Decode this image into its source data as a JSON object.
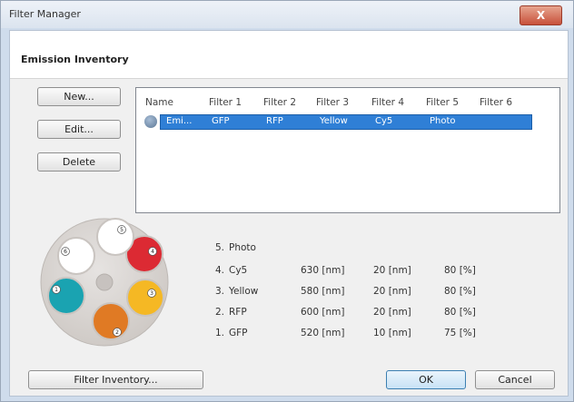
{
  "window": {
    "title": "Filter Manager",
    "close_glyph": "X"
  },
  "section": {
    "title": "Emission Inventory"
  },
  "buttons": {
    "new": "New...",
    "edit": "Edit...",
    "delete": "Delete",
    "filter_inventory": "Filter Inventory...",
    "ok": "OK",
    "cancel": "Cancel"
  },
  "table": {
    "columns": [
      "Name",
      "Filter 1",
      "Filter 2",
      "Filter 3",
      "Filter 4",
      "Filter 5",
      "Filter 6"
    ],
    "rows": [
      {
        "name": "Emi...",
        "filter1": "GFP",
        "filter2": "RFP",
        "filter3": "Yellow",
        "filter4": "Cy5",
        "filter5": "Photo",
        "filter6": "",
        "selected": true
      }
    ]
  },
  "wheel": {
    "positions": [
      {
        "label": "1",
        "color": "#1aa3b1"
      },
      {
        "label": "2",
        "color": "#e07a24"
      },
      {
        "label": "3",
        "color": "#f5b824"
      },
      {
        "label": "4",
        "color": "#dc2a33"
      },
      {
        "label": "5",
        "color": "#ffffff"
      },
      {
        "label": "6",
        "color": "#ffffff"
      }
    ],
    "plate_color": "#d9d5d2",
    "hub_color": "#c7c2bf"
  },
  "filter_list": [
    {
      "index": "5.",
      "name": "Photo",
      "wavelength": "",
      "bandwidth": "",
      "transmission": ""
    },
    {
      "index": "4.",
      "name": "Cy5",
      "wavelength": "630 [nm]",
      "bandwidth": "20 [nm]",
      "transmission": "80 [%]"
    },
    {
      "index": "3.",
      "name": "Yellow",
      "wavelength": "580 [nm]",
      "bandwidth": "20 [nm]",
      "transmission": "80 [%]"
    },
    {
      "index": "2.",
      "name": "RFP",
      "wavelength": "600 [nm]",
      "bandwidth": "20 [nm]",
      "transmission": "80 [%]"
    },
    {
      "index": "1.",
      "name": "GFP",
      "wavelength": "520 [nm]",
      "bandwidth": "10 [nm]",
      "transmission": "75 [%]"
    }
  ],
  "colors": {
    "selection": "#2f7fd6",
    "title_bar": "#dbe4ef",
    "close_button": "#c8513b"
  }
}
